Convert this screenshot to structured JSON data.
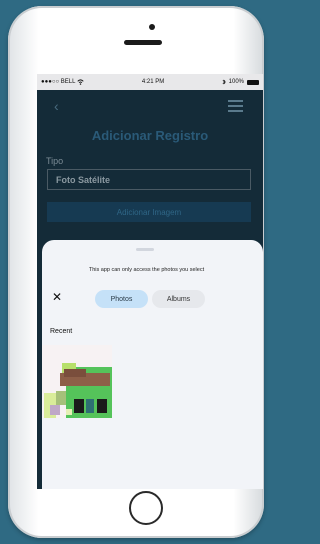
{
  "status": {
    "carrier": "●●●○○ BELL",
    "wifi": "wifi-icon",
    "time": "4:21 PM",
    "bluetooth": "bluetooth-icon",
    "battery_pct": "100%"
  },
  "app": {
    "title": "Adicionar Registro",
    "field_label": "Tipo",
    "field_value": "Foto Satélite",
    "button_label": "Adicionar Imagem"
  },
  "sheet": {
    "notice": "This app can only access the photos you select",
    "close_icon": "close-icon",
    "tabs": [
      {
        "label": "Photos",
        "selected": true
      },
      {
        "label": "Albums",
        "selected": false
      }
    ],
    "section_title": "Recent",
    "accent_color": "#c5e1f8"
  }
}
